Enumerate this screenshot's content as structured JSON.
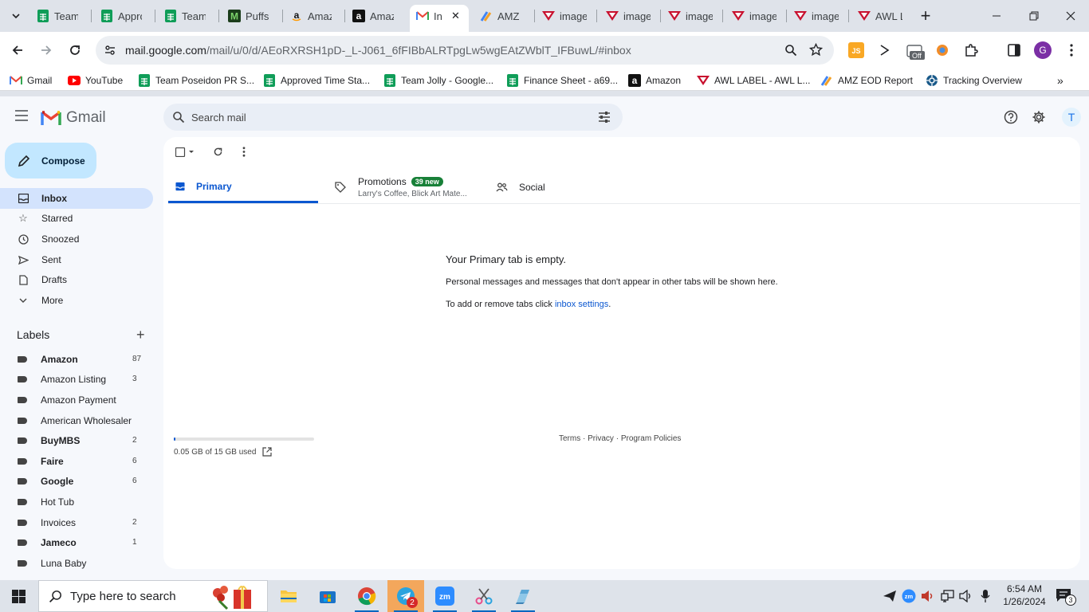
{
  "tabs": [
    {
      "title": "Team P",
      "icon": "google-sheets-icon"
    },
    {
      "title": "Appro",
      "icon": "google-sheets-icon"
    },
    {
      "title": "Team",
      "icon": "google-sheets-icon"
    },
    {
      "title": "Puffs",
      "icon": "puffs-m-icon"
    },
    {
      "title": "Amaz",
      "icon": "amazon-smile-icon"
    },
    {
      "title": "Amaz",
      "icon": "amazon-a-icon"
    },
    {
      "title": "In",
      "icon": "gmail-icon"
    },
    {
      "title": "AMZ",
      "icon": "amz-eod-icon"
    },
    {
      "title": "image",
      "icon": "awl-icon"
    },
    {
      "title": "image",
      "icon": "awl-icon"
    },
    {
      "title": "image",
      "icon": "awl-icon"
    },
    {
      "title": "image",
      "icon": "awl-icon"
    },
    {
      "title": "image",
      "icon": "awl-icon"
    },
    {
      "title": "AWL L",
      "icon": "awl-icon"
    }
  ],
  "toolbar": {
    "url_main": "mail.google.com",
    "url_rest": "/mail/u/0/d/AEoRXRSH1pD-_L-J061_6fFIBbALRTpgLw5wgEAtZWblT_IFBuwL/#inbox",
    "profile_initial": "G",
    "ext_off_label": "Off"
  },
  "bookmarks": [
    {
      "label": "Gmail",
      "icon": "gmail-icon"
    },
    {
      "label": "YouTube",
      "icon": "youtube-icon"
    },
    {
      "label": "Team Poseidon PR S...",
      "icon": "google-sheets-icon"
    },
    {
      "label": "Approved Time Sta...",
      "icon": "google-sheets-icon"
    },
    {
      "label": "Team Jolly - Google...",
      "icon": "google-sheets-icon"
    },
    {
      "label": "Finance Sheet - a69...",
      "icon": "google-sheets-icon"
    },
    {
      "label": "Amazon",
      "icon": "amazon-a-icon"
    },
    {
      "label": "AWL LABEL - AWL L...",
      "icon": "awl-icon"
    },
    {
      "label": "AMZ EOD Report",
      "icon": "amz-eod-icon"
    },
    {
      "label": "Tracking Overview",
      "icon": "tracking-icon"
    }
  ],
  "gmail": {
    "logo_text": "Gmail",
    "compose": "Compose",
    "search_placeholder": "Search mail",
    "avatar_initial": "T",
    "nav": [
      {
        "label": "Inbox",
        "icon": "inbox-icon"
      },
      {
        "label": "Starred",
        "icon": "star-icon"
      },
      {
        "label": "Snoozed",
        "icon": "clock-icon"
      },
      {
        "label": "Sent",
        "icon": "send-icon"
      },
      {
        "label": "Drafts",
        "icon": "draft-icon"
      },
      {
        "label": "More",
        "icon": "chevron-down-icon"
      }
    ],
    "labels_heading": "Labels",
    "labels": [
      {
        "name": "Amazon",
        "count": "87",
        "bold": true
      },
      {
        "name": "Amazon Listing",
        "count": "3",
        "bold": false
      },
      {
        "name": "Amazon Payment",
        "count": "",
        "bold": false
      },
      {
        "name": "American Wholesaler",
        "count": "",
        "bold": false
      },
      {
        "name": "BuyMBS",
        "count": "2",
        "bold": true
      },
      {
        "name": "Faire",
        "count": "6",
        "bold": true
      },
      {
        "name": "Google",
        "count": "6",
        "bold": true
      },
      {
        "name": "Hot Tub",
        "count": "",
        "bold": false
      },
      {
        "name": "Invoices",
        "count": "2",
        "bold": false
      },
      {
        "name": "Jameco",
        "count": "1",
        "bold": true
      },
      {
        "name": "Luna Baby",
        "count": "",
        "bold": false
      }
    ],
    "inbox_tabs": {
      "primary": "Primary",
      "promotions": "Promotions",
      "promotions_badge": "39 new",
      "promotions_snippet": "Larry's Coffee, Blick Art Mate...",
      "social": "Social"
    },
    "empty": {
      "title": "Your Primary tab is empty.",
      "line1": "Personal messages and messages that don't appear in other tabs will be shown here.",
      "line2_prefix": "To add or remove tabs click ",
      "line2_link": "inbox settings",
      "line2_suffix": "."
    },
    "storage": {
      "text": "0.05 GB of 15 GB used",
      "fraction": 0.0033
    },
    "footer": {
      "terms": "Terms",
      "sep1": " · ",
      "privacy": "Privacy",
      "sep2": " · ",
      "policies": "Program Policies"
    }
  },
  "taskbar": {
    "search_placeholder": "Type here to search",
    "telegram_badge": "2",
    "time": "6:54 AM",
    "date": "1/26/2024",
    "notification_count": "3"
  }
}
